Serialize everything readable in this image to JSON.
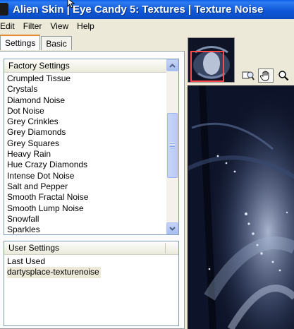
{
  "window": {
    "title": "Alien Skin | Eye Candy 5: Textures | Texture Noise"
  },
  "menu": {
    "items": [
      "Edit",
      "Filter",
      "View",
      "Help"
    ]
  },
  "tabs": [
    {
      "label": "Settings",
      "active": true
    },
    {
      "label": "Basic",
      "active": false
    }
  ],
  "factory_settings": {
    "header": "Factory Settings",
    "items": [
      "Crumpled Tissue",
      "Crystals",
      "Diamond Noise",
      "Dot Noise",
      "Grey Crinkles",
      "Grey Diamonds",
      "Grey Squares",
      "Heavy Rain",
      "Hue Crazy Diamonds",
      "Intense Dot Noise",
      "Salt and Pepper",
      "Smooth Fractal Noise",
      "Smooth Lump Noise",
      "Snowfall",
      "Sparkles"
    ]
  },
  "user_settings": {
    "header": "User Settings",
    "items": [
      "Last Used",
      "dartysplace-texturenoise"
    ],
    "selected_index": 1
  },
  "tools": {
    "zoom_to_fit": "zoom-to-fit-icon",
    "pan": "hand-icon",
    "zoom": "magnifier-icon"
  },
  "colors": {
    "titlebar": "#0a4bc4",
    "selection_box": "#ff4a4a"
  }
}
